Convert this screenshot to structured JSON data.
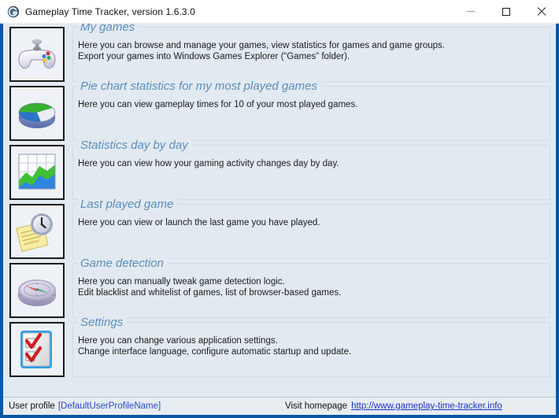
{
  "window": {
    "title": "Gameplay Time Tracker, version 1.6.3.0",
    "app_icon": "gameplay-time-tracker-logo-icon",
    "frame_color": "#0a57a4",
    "client_bg": "#e2e9f0",
    "heading_color": "#5b8ebd",
    "controls": {
      "minimize_label": "Minimize",
      "maximize_label": "Maximize",
      "close_label": "Close"
    }
  },
  "sections": [
    {
      "icon": "gamepad-icon",
      "title": "My games",
      "lines": [
        "Here you can browse and manage your games, view statistics for games and game groups.",
        "Export your games into Windows Games Explorer (“Games” folder)."
      ]
    },
    {
      "icon": "pie-chart-icon",
      "title": "Pie chart statistics for my most played games",
      "lines": [
        "Here you can view gameplay times for 10 of your most played games."
      ]
    },
    {
      "icon": "area-chart-icon",
      "title": "Statistics day by day",
      "lines": [
        "Here you can view how your gaming activity changes day by day."
      ]
    },
    {
      "icon": "clock-notepad-icon",
      "title": "Last played game",
      "lines": [
        "Here you can view or launch the last game you have played."
      ]
    },
    {
      "icon": "compass-icon",
      "title": "Game detection",
      "lines": [
        "Here you can manually tweak game detection logic.",
        "Edit blacklist and whitelist of games, list of browser-based games."
      ]
    },
    {
      "icon": "checklist-icon",
      "title": "Settings",
      "lines": [
        "Here you can change various application settings.",
        "Change interface language, configure automatic startup and update."
      ]
    }
  ],
  "statusbar": {
    "profile_label": "User profile",
    "profile_value": "[DefaultUserProfileName]",
    "homepage_label": "Visit homepage",
    "homepage_url": "http://www.gameplay-time-tracker.info",
    "link_color": "#1a33c4"
  }
}
